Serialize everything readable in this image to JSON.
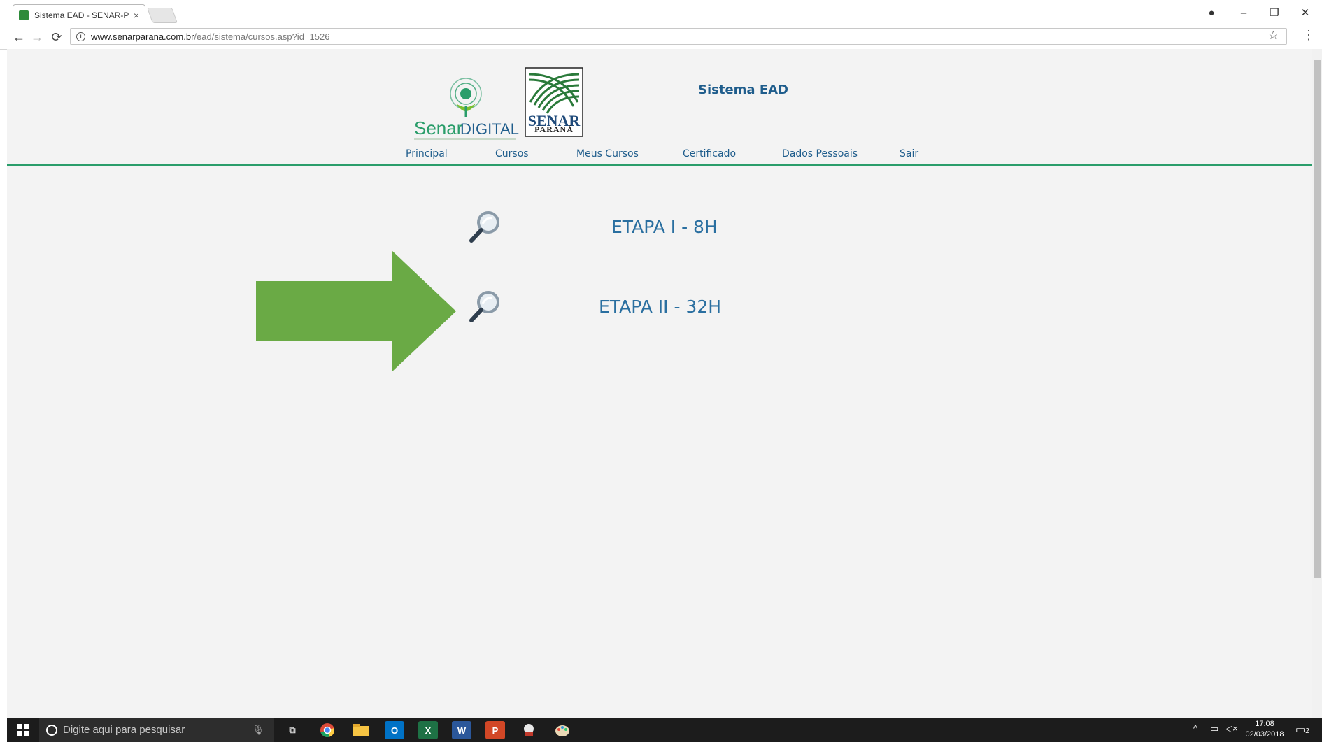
{
  "browser": {
    "tab_title": "Sistema EAD - SENAR-PR",
    "tab_close": "×",
    "url_host": "www.senarparana.com.br",
    "url_path": "/ead/sistema/cursos.asp?id=1526",
    "back": "←",
    "forward": "→",
    "reload": "⟳",
    "bookmark": "☆",
    "menu": "⋮",
    "window_controls": {
      "account": "●",
      "minimize": "–",
      "restore": "❐",
      "close": "✕"
    }
  },
  "header": {
    "logo_senar_digital_a": "Senar",
    "logo_senar_digital_b": "DIGITAL",
    "logo_senar": "SENAR",
    "logo_parana": "PARANÁ",
    "site_title": "Sistema EAD"
  },
  "nav": {
    "items": [
      {
        "label": "Principal"
      },
      {
        "label": "Cursos"
      },
      {
        "label": "Meus Cursos"
      },
      {
        "label": "Certificado"
      },
      {
        "label": "Dados Pessoais"
      },
      {
        "label": "Sair"
      }
    ]
  },
  "courses": [
    {
      "label": "ETAPA I - 8H",
      "icon": "magnifier-icon"
    },
    {
      "label": "ETAPA II - 32H",
      "icon": "magnifier-icon"
    }
  ],
  "annotation": {
    "icon": "green-arrow-icon",
    "color": "#6aaa45"
  },
  "taskbar": {
    "search_placeholder": "Digite aqui para pesquisar",
    "apps": [
      {
        "name": "task-view-icon",
        "text": "⧉"
      },
      {
        "name": "chrome-icon",
        "text": ""
      },
      {
        "name": "file-explorer-icon",
        "text": ""
      },
      {
        "name": "outlook-icon",
        "text": "O"
      },
      {
        "name": "excel-icon",
        "text": "X"
      },
      {
        "name": "word-icon",
        "text": "W"
      },
      {
        "name": "powerpoint-icon",
        "text": "P"
      },
      {
        "name": "app-icon-1",
        "text": ""
      },
      {
        "name": "paint-icon",
        "text": ""
      }
    ],
    "tray_arrow": "^",
    "time": "17:08",
    "date": "02/03/2018",
    "notifications": "2"
  },
  "colors": {
    "link": "#1f5d8c",
    "accent_line": "#2a9d6a",
    "background": "#f3f3f3"
  }
}
